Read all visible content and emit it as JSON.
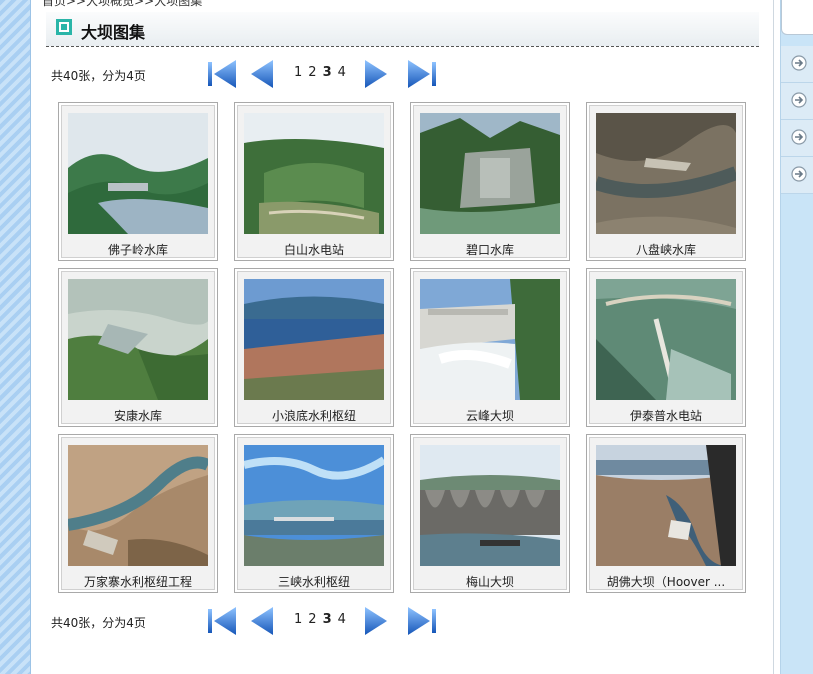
{
  "breadcrumb": "首页>>大坝概览>>大坝图集",
  "section": {
    "title": "大坝图集"
  },
  "pager": {
    "summary": "共40张，分为4页",
    "pages": [
      "1",
      "2",
      "3",
      "4"
    ],
    "current_page": "3",
    "first_icon": "first-page-icon",
    "prev_icon": "prev-page-icon",
    "next_icon": "next-page-icon",
    "last_icon": "last-page-icon"
  },
  "gallery": [
    {
      "caption": "佛子岭水库"
    },
    {
      "caption": "白山水电站"
    },
    {
      "caption": "碧口水库"
    },
    {
      "caption": "八盘峡水库"
    },
    {
      "caption": "安康水库"
    },
    {
      "caption": "小浪底水利枢纽"
    },
    {
      "caption": "云峰大坝"
    },
    {
      "caption": "伊泰普水电站"
    },
    {
      "caption": "万家寨水利枢纽工程"
    },
    {
      "caption": "三峡水利枢纽"
    },
    {
      "caption": "梅山大坝"
    },
    {
      "caption": "胡佛大坝（Hoover ..."
    }
  ],
  "colors": {
    "accent": "#2ab5a8",
    "pager_blue": "#1f6fd0",
    "side": "#c9e4f7"
  },
  "right_panel": {
    "rows": 4,
    "icon": "arrow-right-circle-icon"
  }
}
